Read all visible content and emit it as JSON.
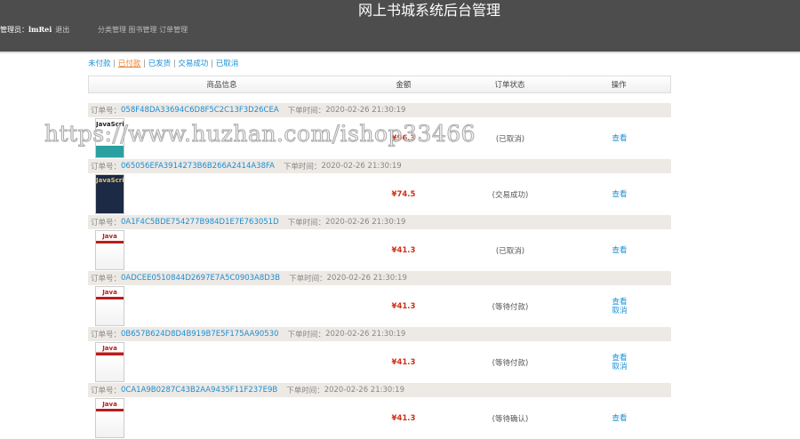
{
  "header": {
    "title": "网上书城系统后台管理",
    "admin_label": "管理员：",
    "admin_name": "lmRei",
    "logout": "退出",
    "menu": [
      "分类管理",
      "图书管理",
      "订单管理"
    ]
  },
  "tabs": [
    {
      "label": "未付款"
    },
    {
      "label": "已付款",
      "active": true
    },
    {
      "label": "已发货"
    },
    {
      "label": "交易成功"
    },
    {
      "label": "已取消"
    }
  ],
  "separator": "|",
  "columns": [
    "商品信息",
    "金额",
    "订单状态",
    "操作"
  ],
  "order_no_label": "订单号：",
  "order_time_label": "下单时间：",
  "orders": [
    {
      "no": "058F48DA33694C6D8F5C2C13F3D26CEA",
      "time": "2020-02-26 21:30:19",
      "amount": "¥96.3",
      "status": "(已取消)",
      "actions": [
        "查看"
      ],
      "cover": "rhino"
    },
    {
      "no": "065056EFA3914273B6B266A2414A38FA",
      "time": "2020-02-26 21:30:19",
      "amount": "¥74.5",
      "status": "(交易成功)",
      "actions": [
        "查看"
      ],
      "cover": "dark"
    },
    {
      "no": "0A1F4C5BDE754277B984D1E7E763051D",
      "time": "2020-02-26 21:30:19",
      "amount": "¥41.3",
      "status": "(已取消)",
      "actions": [
        "查看"
      ],
      "cover": "java"
    },
    {
      "no": "0ADCEE0510844D2697E7A5C0903A8D3B",
      "time": "2020-02-26 21:30:19",
      "amount": "¥41.3",
      "status": "(等待付款)",
      "actions": [
        "查看",
        "取消"
      ],
      "cover": "java"
    },
    {
      "no": "0B657B624D8D4B919B7E5F175AA90530",
      "time": "2020-02-26 21:30:19",
      "amount": "¥41.3",
      "status": "(等待付款)",
      "actions": [
        "查看",
        "取消"
      ],
      "cover": "java"
    },
    {
      "no": "0CA1A9B0287C43B2AA9435F11F237E9B",
      "time": "2020-02-26 21:30:19",
      "amount": "¥41.3",
      "status": "(等待确认)",
      "actions": [
        "查看"
      ],
      "cover": "java"
    }
  ],
  "cover_text": {
    "java": "Java",
    "dark": "JavaScript",
    "rhino": "JavaScript"
  },
  "watermark": "https://www.huzhan.com/ishop33466"
}
